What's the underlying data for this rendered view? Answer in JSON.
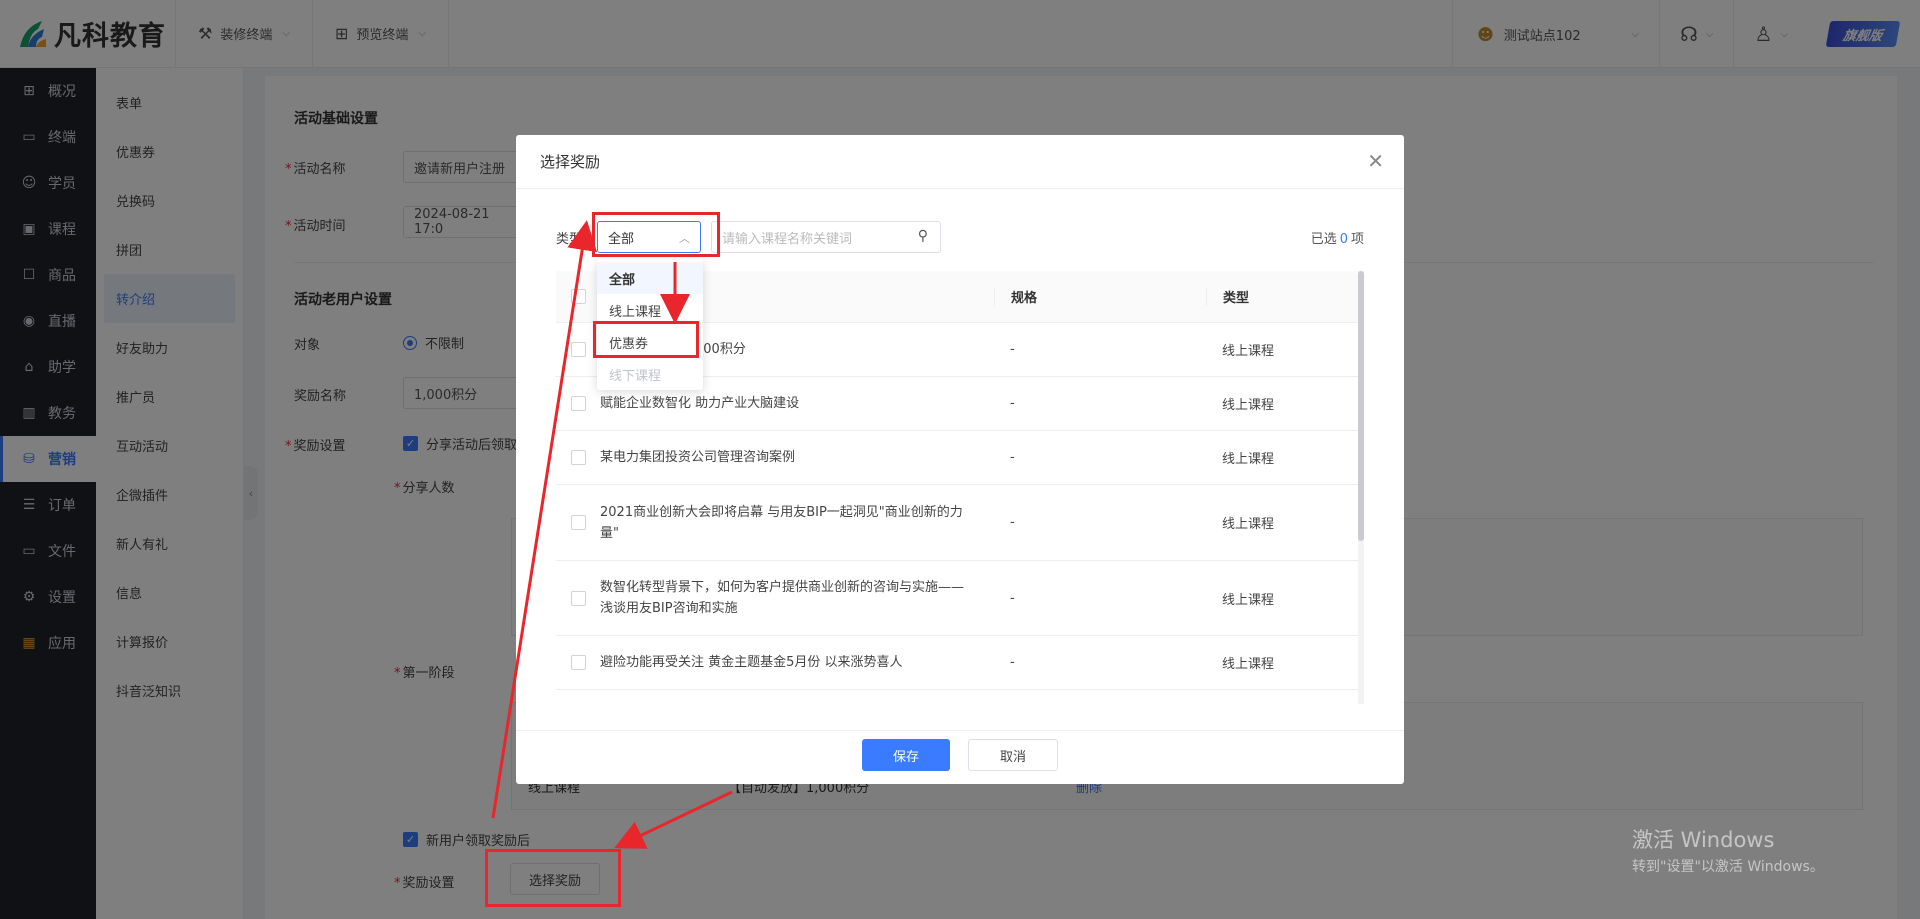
{
  "brand": {
    "name": "凡科教育"
  },
  "topbar": {
    "menu": [
      {
        "label": "装修终端",
        "icon": "brush-icon"
      },
      {
        "label": "预览终端",
        "icon": "grid-icon"
      }
    ],
    "site": "测试站点102",
    "edition": "旗舰版"
  },
  "sidebar": {
    "items": [
      {
        "label": "概况",
        "icon": "grid-icon"
      },
      {
        "label": "终端",
        "icon": "monitor-icon"
      },
      {
        "label": "学员",
        "icon": "users-icon"
      },
      {
        "label": "课程",
        "icon": "course-icon"
      },
      {
        "label": "商品",
        "icon": "goods-icon"
      },
      {
        "label": "直播",
        "icon": "live-icon"
      },
      {
        "label": "助学",
        "icon": "help-icon"
      },
      {
        "label": "教务",
        "icon": "book-icon"
      },
      {
        "label": "营销",
        "icon": "marketing-icon"
      },
      {
        "label": "订单",
        "icon": "order-icon"
      },
      {
        "label": "文件",
        "icon": "folder-icon"
      },
      {
        "label": "设置",
        "icon": "gear-icon"
      },
      {
        "label": "应用",
        "icon": "apps-icon"
      }
    ],
    "active": "营销"
  },
  "submenu": {
    "items": [
      "表单",
      "优惠券",
      "兑换码",
      "拼团",
      "转介绍",
      "好友助力",
      "推广员",
      "互动活动",
      "企微插件",
      "新人有礼",
      "信息",
      "计算报价",
      "抖音泛知识"
    ],
    "active": "转介绍"
  },
  "form": {
    "basic_title": "活动基础设置",
    "activity_name_label": "活动名称",
    "activity_name_value": "邀请新用户注册",
    "activity_time_label": "活动时间",
    "activity_time_value": "2024-08-21 17:0",
    "old_user_title": "活动老用户设置",
    "target_label": "对象",
    "target_option": "不限制",
    "reward_name_label": "奖励名称",
    "reward_name_value": "1,000积分",
    "reward_setting_label": "奖励设置",
    "share_checkbox": "分享活动后领取",
    "share_count_label": "分享人数",
    "stage_one_label": "第一阶段",
    "bg_row_type": "线上课程",
    "bg_row_reward": "【自动发放】1,000积分",
    "bg_row_delete": "删除",
    "new_user_checkbox": "新用户领取奖励后",
    "reward_setting_label2": "奖励设置",
    "choose_reward_button": "选择奖励"
  },
  "modal": {
    "title": "选择奖励",
    "type_label": "类型:",
    "type_value": "全部",
    "search_placeholder": "请输入课程名称关键词",
    "selected_prefix": "已选",
    "selected_count": "0",
    "selected_suffix": "项",
    "columns": [
      "规格",
      "类型"
    ],
    "rows": [
      {
        "name": "000积分",
        "spec": "-",
        "type": "线上课程"
      },
      {
        "name": "赋能企业数智化 助力产业大脑建设",
        "spec": "-",
        "type": "线上课程"
      },
      {
        "name": "某电力集团投资公司管理咨询案例",
        "spec": "-",
        "type": "线上课程"
      },
      {
        "name": "2021商业创新大会即将启幕 与用友BIP一起洞见\"商业创新的力量\"",
        "spec": "-",
        "type": "线上课程"
      },
      {
        "name": "数智化转型背景下，如何为客户提供商业创新的咨询与实施——浅谈用友BIP咨询和实施",
        "spec": "-",
        "type": "线上课程"
      },
      {
        "name": "避险功能再受关注 黄金主题基金5月份 以来涨势喜人",
        "spec": "-",
        "type": "线上课程"
      }
    ],
    "save_label": "保存",
    "cancel_label": "取消"
  },
  "dropdown": {
    "options": [
      "全部",
      "线上课程",
      "优惠券",
      "线下课程"
    ],
    "selected": "全部",
    "disabled": "线下课程"
  },
  "watermark": {
    "title": "激活 Windows",
    "subtitle": "转到\"设置\"以激活 Windows。"
  },
  "colors": {
    "accent": "#3a7bff",
    "annotation": "#e8262b",
    "sidebar_bg": "#1f2229"
  }
}
